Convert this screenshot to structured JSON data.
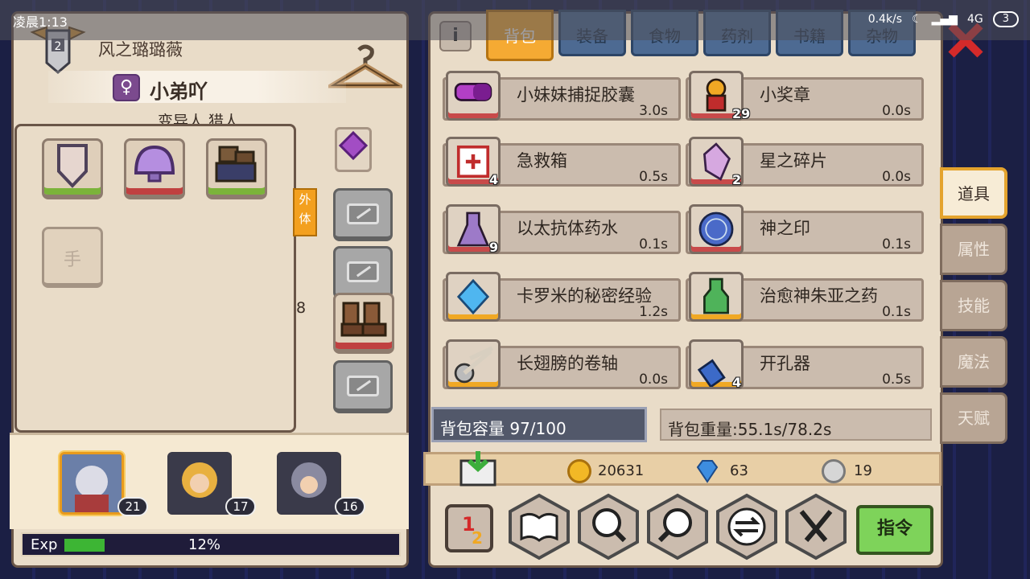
{
  "status": {
    "time": "凌晨1:13",
    "network_speed": "0.4k/s",
    "signal": "4G",
    "battery": "3"
  },
  "character": {
    "name": "风之璐璐薇",
    "title": "小弟吖",
    "class_partial": "变异人 猎人",
    "gender_symbol": "♀"
  },
  "equip": {
    "hand_slot_label": "手",
    "tag_text": "外\n体",
    "partial_number": "8"
  },
  "party": [
    {
      "level": "21",
      "selected": true
    },
    {
      "level": "17",
      "selected": false
    },
    {
      "level": "16",
      "selected": false
    }
  ],
  "exp": {
    "label": "Exp",
    "percent_text": "12%",
    "fill": 0.12
  },
  "tabs": [
    "背包",
    "装备",
    "食物",
    "药剂",
    "书籍",
    "杂物"
  ],
  "active_tab": "背包",
  "items": [
    {
      "name": "小妹妹捕捉胶囊",
      "weight": "3.0s",
      "qty": "",
      "border": "red"
    },
    {
      "name": "小奖章",
      "weight": "0.0s",
      "qty": "29",
      "border": "red"
    },
    {
      "name": "急救箱",
      "weight": "0.5s",
      "qty": "4",
      "border": "red"
    },
    {
      "name": "星之碎片",
      "weight": "0.0s",
      "qty": "2",
      "border": "red"
    },
    {
      "name": "以太抗体药水",
      "weight": "0.1s",
      "qty": "9",
      "border": "red"
    },
    {
      "name": "神之印",
      "weight": "0.1s",
      "qty": "",
      "border": "red"
    },
    {
      "name": "卡罗米的秘密经验",
      "weight": "1.2s",
      "qty": "",
      "border": "gold"
    },
    {
      "name": "治愈神朱亚之药",
      "weight": "0.1s",
      "qty": "",
      "border": "gold"
    },
    {
      "name": "长翅膀的卷轴",
      "weight": "0.0s",
      "qty": "",
      "border": "gold"
    },
    {
      "name": "开孔器",
      "weight": "0.5s",
      "qty": "4",
      "border": "gold"
    }
  ],
  "bag": {
    "capacity_text": "背包容量 97/100",
    "weight_text": "背包重量:55.1s/78.2s"
  },
  "currency": {
    "gold": "20631",
    "diamond": "63",
    "silver": "19"
  },
  "command_label": "指令",
  "side_tabs": [
    "道具",
    "属性",
    "技能",
    "魔法",
    "天赋"
  ],
  "active_side_tab": "道具",
  "colors": {
    "accent": "#f5aa33",
    "panel": "#e9dcc8",
    "border": "#6a5648",
    "tab_blue": "#4d6a92",
    "command_green": "#7ed35a"
  }
}
